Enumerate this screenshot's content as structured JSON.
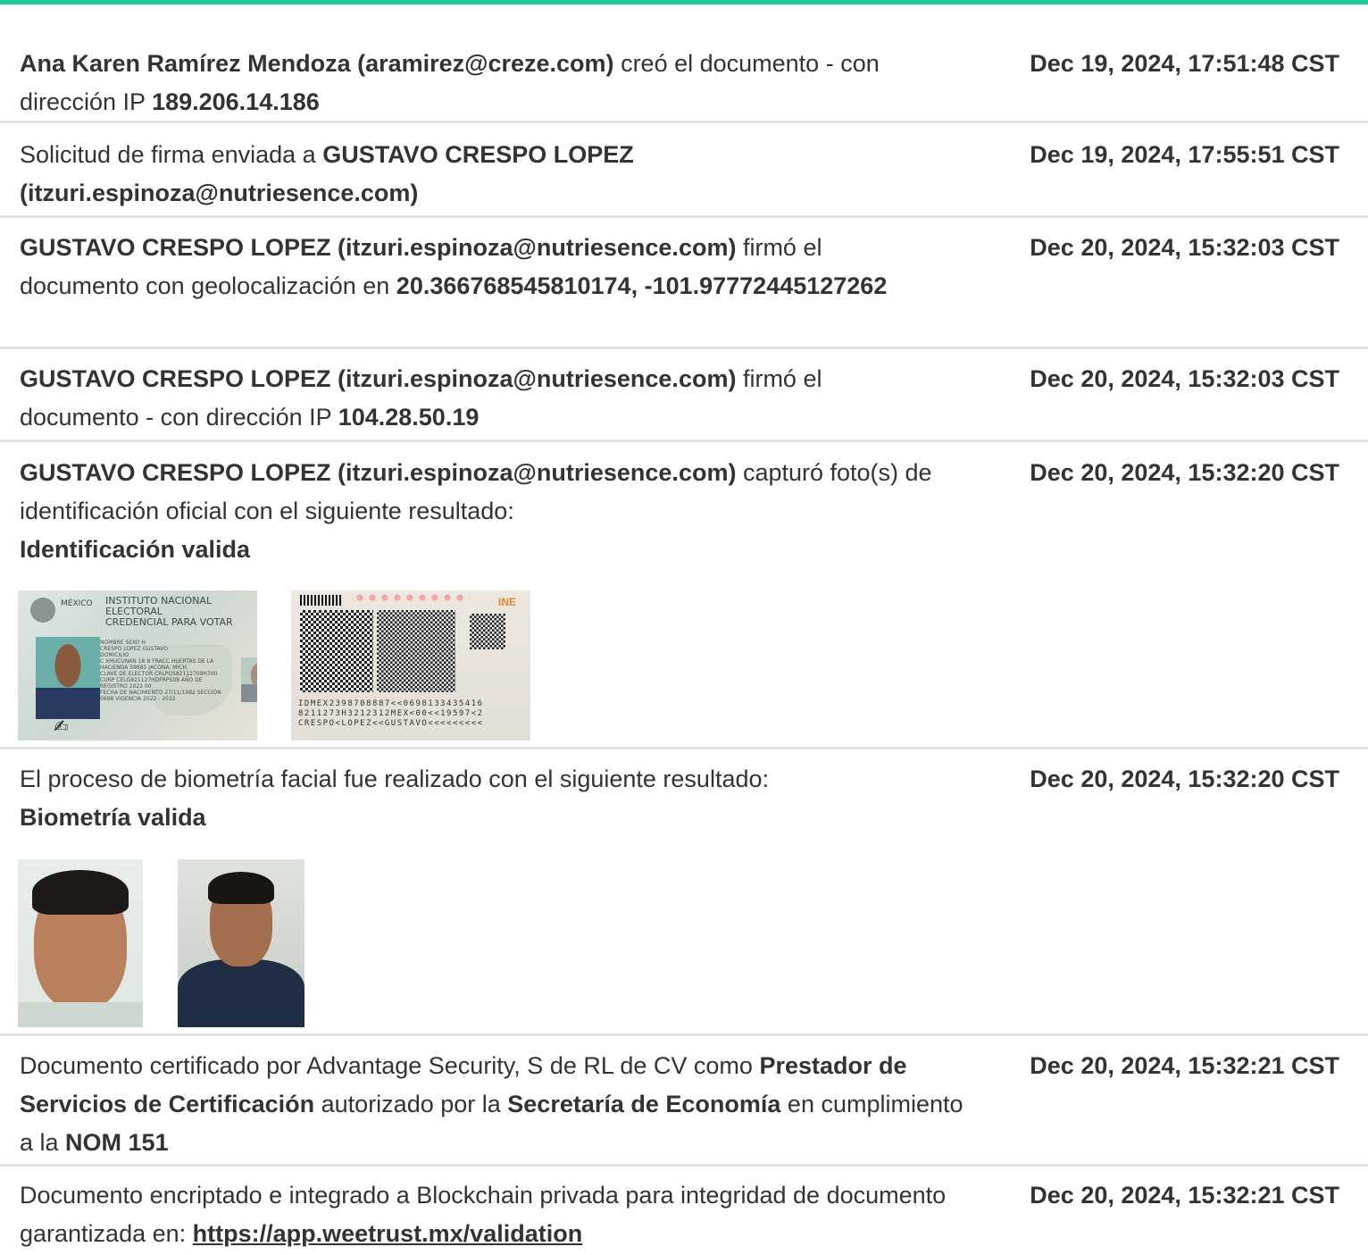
{
  "accent_color": "#1cc99c",
  "events": [
    {
      "parts": [
        {
          "t": "Ana Karen Ramírez Mendoza (aramirez@creze.com)",
          "b": true
        },
        {
          "t": " creó el documento - con dirección IP ",
          "b": false
        },
        {
          "t": "189.206.14.186",
          "b": true
        }
      ],
      "date": "Dec 19, 2024, 17:51:48 CST"
    },
    {
      "parts": [
        {
          "t": "Solicitud de firma enviada a ",
          "b": false
        },
        {
          "t": "GUSTAVO CRESPO LOPEZ (itzuri.espinoza@nutriesence.com)",
          "b": true
        }
      ],
      "date": "Dec 19, 2024, 17:55:51 CST"
    },
    {
      "parts": [
        {
          "t": "GUSTAVO CRESPO LOPEZ (itzuri.espinoza@nutriesence.com)",
          "b": true
        },
        {
          "t": " firmó el documento con geolocalización en ",
          "b": false
        },
        {
          "t": "20.366768545810174, -101.97772445127262",
          "b": true
        }
      ],
      "date": "Dec 20, 2024, 15:32:03 CST"
    },
    {
      "parts": [
        {
          "t": "GUSTAVO CRESPO LOPEZ (itzuri.espinoza@nutriesence.com)",
          "b": true
        },
        {
          "t": " firmó el documento - con dirección IP ",
          "b": false
        },
        {
          "t": "104.28.50.19",
          "b": true
        }
      ],
      "date": "Dec 20, 2024, 15:32:03 CST"
    },
    {
      "parts": [
        {
          "t": "GUSTAVO CRESPO LOPEZ (itzuri.espinoza@nutriesence.com)",
          "b": true
        },
        {
          "t": " capturó foto(s) de identificación oficial con el siguiente resultado:",
          "b": false
        },
        {
          "t": "Identificación valida",
          "b": true,
          "br": true
        }
      ],
      "date": "Dec 20, 2024, 15:32:20 CST"
    },
    {
      "parts": [
        {
          "t": "El proceso de biometría facial fue realizado con el siguiente resultado:",
          "b": false
        },
        {
          "t": "Biometría valida",
          "b": true,
          "br": true
        }
      ],
      "date": "Dec 20, 2024, 15:32:20 CST"
    },
    {
      "parts": [
        {
          "t": "Documento certificado por Advantage Security, S de RL de CV como ",
          "b": false
        },
        {
          "t": "Prestador de Servicios de Certificación",
          "b": true
        },
        {
          "t": " autorizado por la ",
          "b": false
        },
        {
          "t": "Secretaría de Economía",
          "b": true
        },
        {
          "t": " en cumplimiento a la ",
          "b": false
        },
        {
          "t": "NOM 151",
          "b": true
        }
      ],
      "date": "Dec 20, 2024, 15:32:21 CST"
    },
    {
      "parts": [
        {
          "t": "Documento encriptado e integrado a Blockchain privada para integridad de documento garantizada en: ",
          "b": false
        },
        {
          "t": "https://app.weetrust.mx/validation",
          "b": true,
          "link": true
        }
      ],
      "date": "Dec 20, 2024, 15:32:21 CST"
    }
  ],
  "id_front": {
    "country": "MÉXICO",
    "institute": "INSTITUTO NACIONAL ELECTORAL",
    "subtitle": "CREDENCIAL PARA VOTAR",
    "sex": "SEXO H",
    "name_label": "NOMBRE",
    "name": "CRESPO LOPEZ GUSTAVO",
    "address_label": "DOMICILIO",
    "address": "C XHUCUNAN 18 B FRACC HUERTAS DE LA HACIENDA 59885 JACONA, MICH.",
    "elector_key": "CLAVE DE ELECTOR CRLPGS82112709H700",
    "curp": "CURP CELG821127HDFRPS08",
    "registro": "AÑO DE REGISTRO 2022 00",
    "birth": "FECHA DE NACIMIENTO 27/11/1982",
    "seccion": "SECCIÓN 0698",
    "vigencia": "VIGENCIA 2022 - 2032"
  },
  "id_back": {
    "brand": "INE",
    "mrz": [
      "IDMEX2398708887<<0698133435416",
      "8211273H3212312MEX<00<<19597<2",
      "CRESPO<LOPEZ<<GUSTAVO<<<<<<<<<"
    ]
  }
}
